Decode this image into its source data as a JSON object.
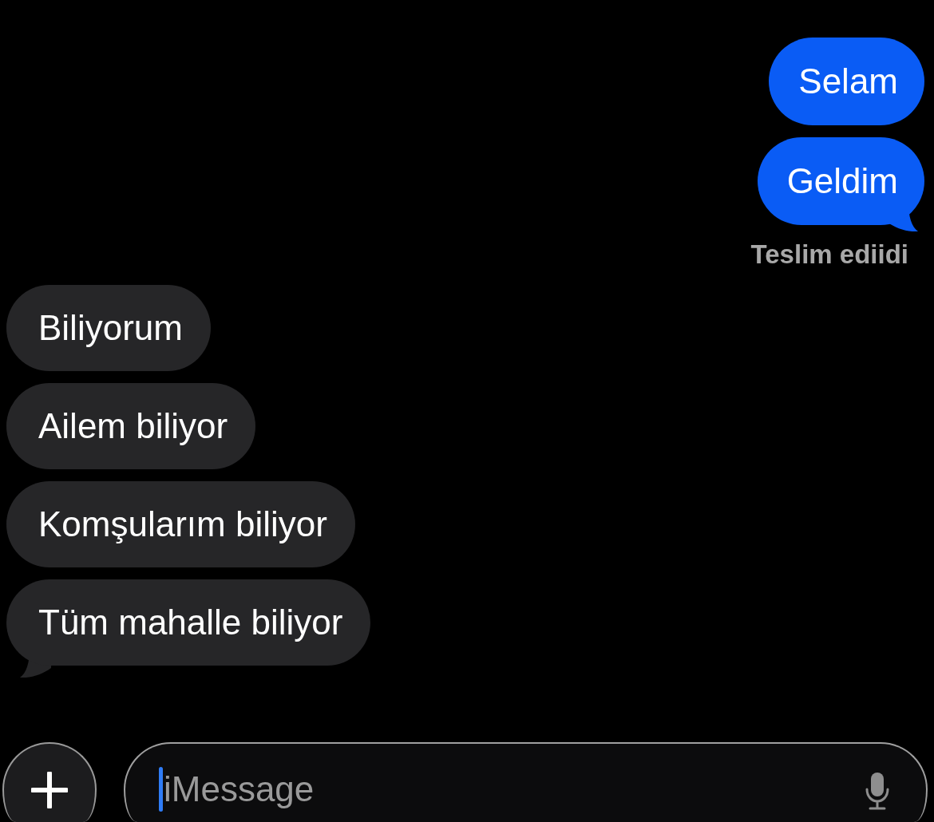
{
  "conversation": [
    {
      "kind": "sent",
      "text": "Selam",
      "tail": false
    },
    {
      "kind": "sent",
      "text": "Geldim",
      "tail": true
    },
    {
      "kind": "status",
      "text": "Teslim ediidi"
    },
    {
      "kind": "received",
      "text": "Biliyorum",
      "tail": false
    },
    {
      "kind": "received",
      "text": "Ailem biliyor",
      "tail": false
    },
    {
      "kind": "received",
      "text": "Komşularım biliyor",
      "tail": false
    },
    {
      "kind": "received",
      "text": "Tüm mahalle biliyor",
      "tail": true
    }
  ],
  "composer": {
    "placeholder": "iMessage"
  }
}
